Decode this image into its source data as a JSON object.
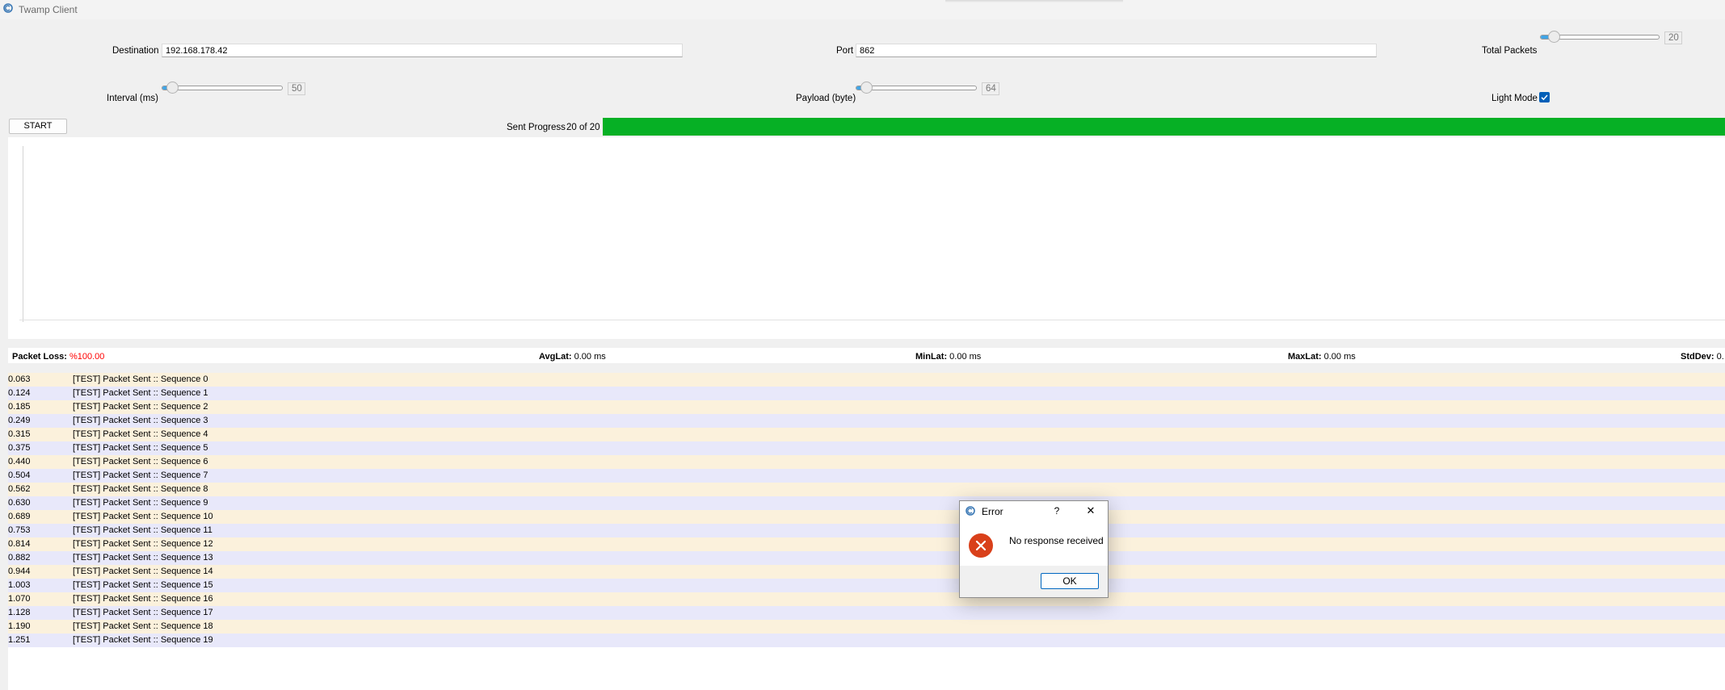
{
  "window": {
    "title": "Twamp Client",
    "app_icon": "app-logo-icon"
  },
  "config": {
    "destination_label": "Destination",
    "destination_value": "192.168.178.42",
    "port_label": "Port",
    "port_value": "862",
    "total_packets_label": "Total Packets",
    "total_packets_value": "20",
    "total_packets_fraction": 0.08,
    "interval_label": "Interval (ms)",
    "interval_value": "50",
    "interval_fraction": 0.04,
    "payload_label": "Payload (byte)",
    "payload_value": "64",
    "payload_fraction": 0.04,
    "light_mode_label": "Light Mode",
    "light_mode_checked": true
  },
  "controls": {
    "start_label": "START"
  },
  "progress": {
    "label": "Sent Progress",
    "text": "20 of 20",
    "fraction": 1.0,
    "color": "#06b025"
  },
  "stats": {
    "loss_label": "Packet Loss:",
    "loss_value": "%100.00",
    "loss_color": "#ff0000",
    "avg_label": "AvgLat:",
    "avg_value": "0.00 ms",
    "min_label": "MinLat:",
    "min_value": "0.00 ms",
    "max_label": "MaxLat:",
    "max_value": "0.00 ms",
    "std_label": "StdDev:",
    "std_value": "0."
  },
  "log": {
    "row_colors": [
      "#fbf1dc",
      "#e8e8fa"
    ],
    "entries": [
      {
        "time": "0.063",
        "message": "[TEST] Packet Sent :: Sequence 0"
      },
      {
        "time": "0.124",
        "message": "[TEST] Packet Sent :: Sequence 1"
      },
      {
        "time": "0.185",
        "message": "[TEST] Packet Sent :: Sequence 2"
      },
      {
        "time": "0.249",
        "message": "[TEST] Packet Sent :: Sequence 3"
      },
      {
        "time": "0.315",
        "message": "[TEST] Packet Sent :: Sequence 4"
      },
      {
        "time": "0.375",
        "message": "[TEST] Packet Sent :: Sequence 5"
      },
      {
        "time": "0.440",
        "message": "[TEST] Packet Sent :: Sequence 6"
      },
      {
        "time": "0.504",
        "message": "[TEST] Packet Sent :: Sequence 7"
      },
      {
        "time": "0.562",
        "message": "[TEST] Packet Sent :: Sequence 8"
      },
      {
        "time": "0.630",
        "message": "[TEST] Packet Sent :: Sequence 9"
      },
      {
        "time": "0.689",
        "message": "[TEST] Packet Sent :: Sequence 10"
      },
      {
        "time": "0.753",
        "message": "[TEST] Packet Sent :: Sequence 11"
      },
      {
        "time": "0.814",
        "message": "[TEST] Packet Sent :: Sequence 12"
      },
      {
        "time": "0.882",
        "message": "[TEST] Packet Sent :: Sequence 13"
      },
      {
        "time": "0.944",
        "message": "[TEST] Packet Sent :: Sequence 14"
      },
      {
        "time": "1.003",
        "message": "[TEST] Packet Sent :: Sequence 15"
      },
      {
        "time": "1.070",
        "message": "[TEST] Packet Sent :: Sequence 16"
      },
      {
        "time": "1.128",
        "message": "[TEST] Packet Sent :: Sequence 17"
      },
      {
        "time": "1.190",
        "message": "[TEST] Packet Sent :: Sequence 18"
      },
      {
        "time": "1.251",
        "message": "[TEST] Packet Sent :: Sequence 19"
      }
    ]
  },
  "dialog": {
    "title": "Error",
    "help_glyph": "?",
    "close_glyph": "✕",
    "message": "No response received",
    "ok_label": "OK",
    "icon": "error-icon",
    "icon_color": "#d9401a"
  }
}
